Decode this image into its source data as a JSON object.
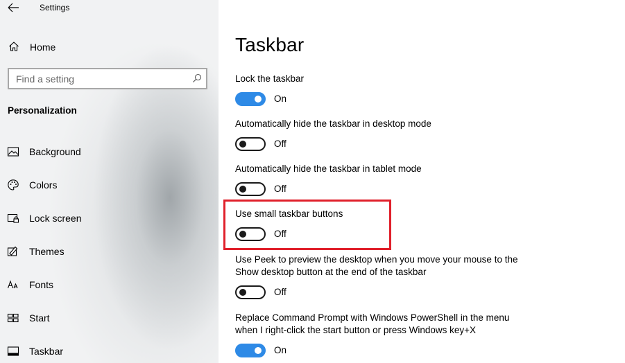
{
  "window": {
    "title": "Settings"
  },
  "sidebar": {
    "home_label": "Home",
    "search": {
      "placeholder": "Find a setting"
    },
    "section_title": "Personalization",
    "items": [
      {
        "label": "Background",
        "icon": "image-icon"
      },
      {
        "label": "Colors",
        "icon": "palette-icon"
      },
      {
        "label": "Lock screen",
        "icon": "lock-screen-icon"
      },
      {
        "label": "Themes",
        "icon": "themes-icon"
      },
      {
        "label": "Fonts",
        "icon": "fonts-icon"
      },
      {
        "label": "Start",
        "icon": "start-icon"
      },
      {
        "label": "Taskbar",
        "icon": "taskbar-icon"
      }
    ]
  },
  "main": {
    "title": "Taskbar",
    "settings": [
      {
        "label": "Lock the taskbar",
        "state": "On"
      },
      {
        "label": "Automatically hide the taskbar in desktop mode",
        "state": "Off"
      },
      {
        "label": "Automatically hide the taskbar in tablet mode",
        "state": "Off"
      },
      {
        "label": "Use small taskbar buttons",
        "state": "Off"
      },
      {
        "label_line1": "Use Peek to preview the desktop when you move your mouse to the",
        "label_line2": "Show desktop button at the end of the taskbar",
        "state": "Off"
      },
      {
        "label_line1": "Replace Command Prompt with Windows PowerShell in the menu",
        "label_line2": "when I right-click the start button or press Windows key+X",
        "state": "On"
      }
    ]
  },
  "colors": {
    "toggle_on": "#2e8ae6",
    "highlight": "#e0202b",
    "sidebar_bg": "#f1f2f3"
  }
}
